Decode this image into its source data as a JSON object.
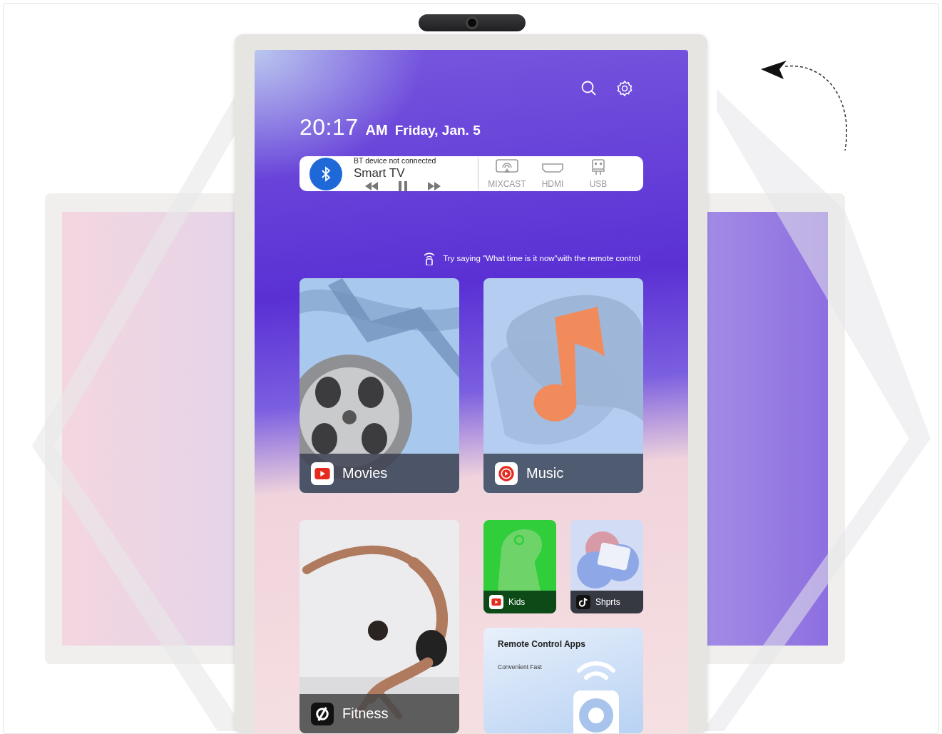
{
  "clock": {
    "time": "20:17",
    "period": "AM",
    "date": "Friday, Jan. 5"
  },
  "media_card": {
    "status": "BT device not connected",
    "device": "Smart TV"
  },
  "sources": [
    {
      "label": "MIXCAST",
      "kind": "cast"
    },
    {
      "label": "HDMI",
      "kind": "hdmi"
    },
    {
      "label": "USB",
      "kind": "usb"
    }
  ],
  "voice_hint": "Try saying \"What time is it now\"with the remote control",
  "tiles": [
    {
      "label": "Movies",
      "kind": "movies"
    },
    {
      "label": "Music",
      "kind": "music"
    },
    {
      "label": "Fitness",
      "kind": "fitness"
    },
    {
      "label": "Kids",
      "kind": "kids"
    },
    {
      "label": "Shprts",
      "kind": "shorts"
    }
  ],
  "remote_card": {
    "title": "Remote Control Apps",
    "subtitle": "Convenient Fast"
  }
}
